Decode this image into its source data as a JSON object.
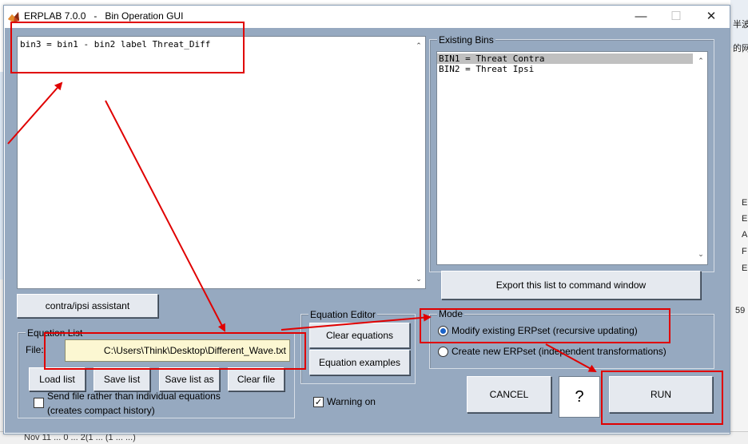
{
  "background": {
    "right_texts": [
      "半波",
      "的网",
      "E",
      "E",
      "A",
      "F",
      "E",
      "59"
    ],
    "bottom_text": "Nov 11 ... 0 ... 2(1 ... (1 ... ...)"
  },
  "window": {
    "title": "ERPLAB 7.0.0   -   Bin Operation GUI",
    "minimize": "—",
    "maximize": "☐",
    "close": "✕"
  },
  "equation_box": {
    "text": "bin3 = bin1 - bin2 label Threat_Diff"
  },
  "existing_bins": {
    "title": "Existing Bins",
    "items": [
      "BIN1 = Threat Contra",
      "BIN2 = Threat Ipsi"
    ],
    "selected_index": 0,
    "export_label": "Export this list to command window"
  },
  "contra_ipsi_button": "contra/ipsi assistant",
  "equation_list": {
    "title": "Equation List",
    "file_label": "File:",
    "file_value": "C:\\Users\\Think\\Desktop\\Different_Wave.txt",
    "buttons": [
      "Load list",
      "Save list",
      "Save list as",
      "Clear file"
    ],
    "send_file_label_1": "Send file rather than individual equations",
    "send_file_label_2": "(creates compact history)",
    "send_file_checked": false
  },
  "equation_editor": {
    "title": "Equation Editor",
    "clear_label": "Clear equations",
    "examples_label": "Equation examples"
  },
  "warning": {
    "label": "Warning on",
    "checked": true
  },
  "mode": {
    "title": "Mode",
    "option_modify": "Modify existing ERPset (recursive updating)",
    "option_create": "Create new ERPset (independent transformations)",
    "selected": "modify"
  },
  "actions": {
    "cancel": "CANCEL",
    "help": "?",
    "run": "RUN"
  },
  "colors": {
    "client_bg": "#96a9c0",
    "annotation_red": "#e00000",
    "file_field_bg": "#fcf7d2"
  }
}
